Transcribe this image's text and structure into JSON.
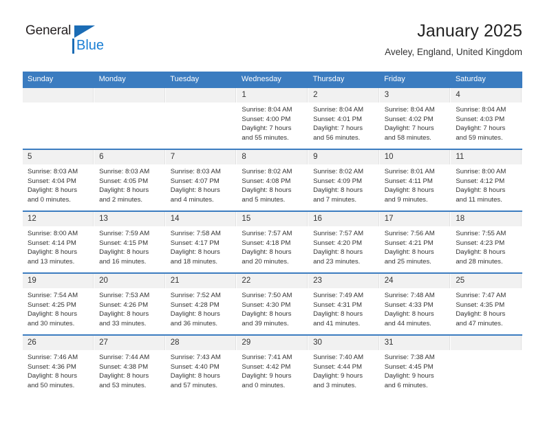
{
  "logo": {
    "name_top": "General",
    "name_bottom": "Blue",
    "triangle_color": "#1b6cb5",
    "blue_color": "#1b7fd4"
  },
  "header": {
    "title": "January 2025",
    "subtitle": "Aveley, England, United Kingdom"
  },
  "theme": {
    "header_bg": "#3b7cc0",
    "daynum_bg": "#f1f1f1",
    "text": "#333333"
  },
  "weekdays": [
    "Sunday",
    "Monday",
    "Tuesday",
    "Wednesday",
    "Thursday",
    "Friday",
    "Saturday"
  ],
  "labels": {
    "sunrise": "Sunrise:",
    "sunset": "Sunset:",
    "daylight": "Daylight:"
  },
  "weeks": [
    [
      {
        "day": "",
        "empty": true
      },
      {
        "day": "",
        "empty": true
      },
      {
        "day": "",
        "empty": true
      },
      {
        "day": "1",
        "sunrise": "Sunrise: 8:04 AM",
        "sunset": "Sunset: 4:00 PM",
        "daylight1": "Daylight: 7 hours",
        "daylight2": "and 55 minutes."
      },
      {
        "day": "2",
        "sunrise": "Sunrise: 8:04 AM",
        "sunset": "Sunset: 4:01 PM",
        "daylight1": "Daylight: 7 hours",
        "daylight2": "and 56 minutes."
      },
      {
        "day": "3",
        "sunrise": "Sunrise: 8:04 AM",
        "sunset": "Sunset: 4:02 PM",
        "daylight1": "Daylight: 7 hours",
        "daylight2": "and 58 minutes."
      },
      {
        "day": "4",
        "sunrise": "Sunrise: 8:04 AM",
        "sunset": "Sunset: 4:03 PM",
        "daylight1": "Daylight: 7 hours",
        "daylight2": "and 59 minutes."
      }
    ],
    [
      {
        "day": "5",
        "sunrise": "Sunrise: 8:03 AM",
        "sunset": "Sunset: 4:04 PM",
        "daylight1": "Daylight: 8 hours",
        "daylight2": "and 0 minutes."
      },
      {
        "day": "6",
        "sunrise": "Sunrise: 8:03 AM",
        "sunset": "Sunset: 4:05 PM",
        "daylight1": "Daylight: 8 hours",
        "daylight2": "and 2 minutes."
      },
      {
        "day": "7",
        "sunrise": "Sunrise: 8:03 AM",
        "sunset": "Sunset: 4:07 PM",
        "daylight1": "Daylight: 8 hours",
        "daylight2": "and 4 minutes."
      },
      {
        "day": "8",
        "sunrise": "Sunrise: 8:02 AM",
        "sunset": "Sunset: 4:08 PM",
        "daylight1": "Daylight: 8 hours",
        "daylight2": "and 5 minutes."
      },
      {
        "day": "9",
        "sunrise": "Sunrise: 8:02 AM",
        "sunset": "Sunset: 4:09 PM",
        "daylight1": "Daylight: 8 hours",
        "daylight2": "and 7 minutes."
      },
      {
        "day": "10",
        "sunrise": "Sunrise: 8:01 AM",
        "sunset": "Sunset: 4:11 PM",
        "daylight1": "Daylight: 8 hours",
        "daylight2": "and 9 minutes."
      },
      {
        "day": "11",
        "sunrise": "Sunrise: 8:00 AM",
        "sunset": "Sunset: 4:12 PM",
        "daylight1": "Daylight: 8 hours",
        "daylight2": "and 11 minutes."
      }
    ],
    [
      {
        "day": "12",
        "sunrise": "Sunrise: 8:00 AM",
        "sunset": "Sunset: 4:14 PM",
        "daylight1": "Daylight: 8 hours",
        "daylight2": "and 13 minutes."
      },
      {
        "day": "13",
        "sunrise": "Sunrise: 7:59 AM",
        "sunset": "Sunset: 4:15 PM",
        "daylight1": "Daylight: 8 hours",
        "daylight2": "and 16 minutes."
      },
      {
        "day": "14",
        "sunrise": "Sunrise: 7:58 AM",
        "sunset": "Sunset: 4:17 PM",
        "daylight1": "Daylight: 8 hours",
        "daylight2": "and 18 minutes."
      },
      {
        "day": "15",
        "sunrise": "Sunrise: 7:57 AM",
        "sunset": "Sunset: 4:18 PM",
        "daylight1": "Daylight: 8 hours",
        "daylight2": "and 20 minutes."
      },
      {
        "day": "16",
        "sunrise": "Sunrise: 7:57 AM",
        "sunset": "Sunset: 4:20 PM",
        "daylight1": "Daylight: 8 hours",
        "daylight2": "and 23 minutes."
      },
      {
        "day": "17",
        "sunrise": "Sunrise: 7:56 AM",
        "sunset": "Sunset: 4:21 PM",
        "daylight1": "Daylight: 8 hours",
        "daylight2": "and 25 minutes."
      },
      {
        "day": "18",
        "sunrise": "Sunrise: 7:55 AM",
        "sunset": "Sunset: 4:23 PM",
        "daylight1": "Daylight: 8 hours",
        "daylight2": "and 28 minutes."
      }
    ],
    [
      {
        "day": "19",
        "sunrise": "Sunrise: 7:54 AM",
        "sunset": "Sunset: 4:25 PM",
        "daylight1": "Daylight: 8 hours",
        "daylight2": "and 30 minutes."
      },
      {
        "day": "20",
        "sunrise": "Sunrise: 7:53 AM",
        "sunset": "Sunset: 4:26 PM",
        "daylight1": "Daylight: 8 hours",
        "daylight2": "and 33 minutes."
      },
      {
        "day": "21",
        "sunrise": "Sunrise: 7:52 AM",
        "sunset": "Sunset: 4:28 PM",
        "daylight1": "Daylight: 8 hours",
        "daylight2": "and 36 minutes."
      },
      {
        "day": "22",
        "sunrise": "Sunrise: 7:50 AM",
        "sunset": "Sunset: 4:30 PM",
        "daylight1": "Daylight: 8 hours",
        "daylight2": "and 39 minutes."
      },
      {
        "day": "23",
        "sunrise": "Sunrise: 7:49 AM",
        "sunset": "Sunset: 4:31 PM",
        "daylight1": "Daylight: 8 hours",
        "daylight2": "and 41 minutes."
      },
      {
        "day": "24",
        "sunrise": "Sunrise: 7:48 AM",
        "sunset": "Sunset: 4:33 PM",
        "daylight1": "Daylight: 8 hours",
        "daylight2": "and 44 minutes."
      },
      {
        "day": "25",
        "sunrise": "Sunrise: 7:47 AM",
        "sunset": "Sunset: 4:35 PM",
        "daylight1": "Daylight: 8 hours",
        "daylight2": "and 47 minutes."
      }
    ],
    [
      {
        "day": "26",
        "sunrise": "Sunrise: 7:46 AM",
        "sunset": "Sunset: 4:36 PM",
        "daylight1": "Daylight: 8 hours",
        "daylight2": "and 50 minutes."
      },
      {
        "day": "27",
        "sunrise": "Sunrise: 7:44 AM",
        "sunset": "Sunset: 4:38 PM",
        "daylight1": "Daylight: 8 hours",
        "daylight2": "and 53 minutes."
      },
      {
        "day": "28",
        "sunrise": "Sunrise: 7:43 AM",
        "sunset": "Sunset: 4:40 PM",
        "daylight1": "Daylight: 8 hours",
        "daylight2": "and 57 minutes."
      },
      {
        "day": "29",
        "sunrise": "Sunrise: 7:41 AM",
        "sunset": "Sunset: 4:42 PM",
        "daylight1": "Daylight: 9 hours",
        "daylight2": "and 0 minutes."
      },
      {
        "day": "30",
        "sunrise": "Sunrise: 7:40 AM",
        "sunset": "Sunset: 4:44 PM",
        "daylight1": "Daylight: 9 hours",
        "daylight2": "and 3 minutes."
      },
      {
        "day": "31",
        "sunrise": "Sunrise: 7:38 AM",
        "sunset": "Sunset: 4:45 PM",
        "daylight1": "Daylight: 9 hours",
        "daylight2": "and 6 minutes."
      },
      {
        "day": "",
        "empty": true
      }
    ]
  ]
}
